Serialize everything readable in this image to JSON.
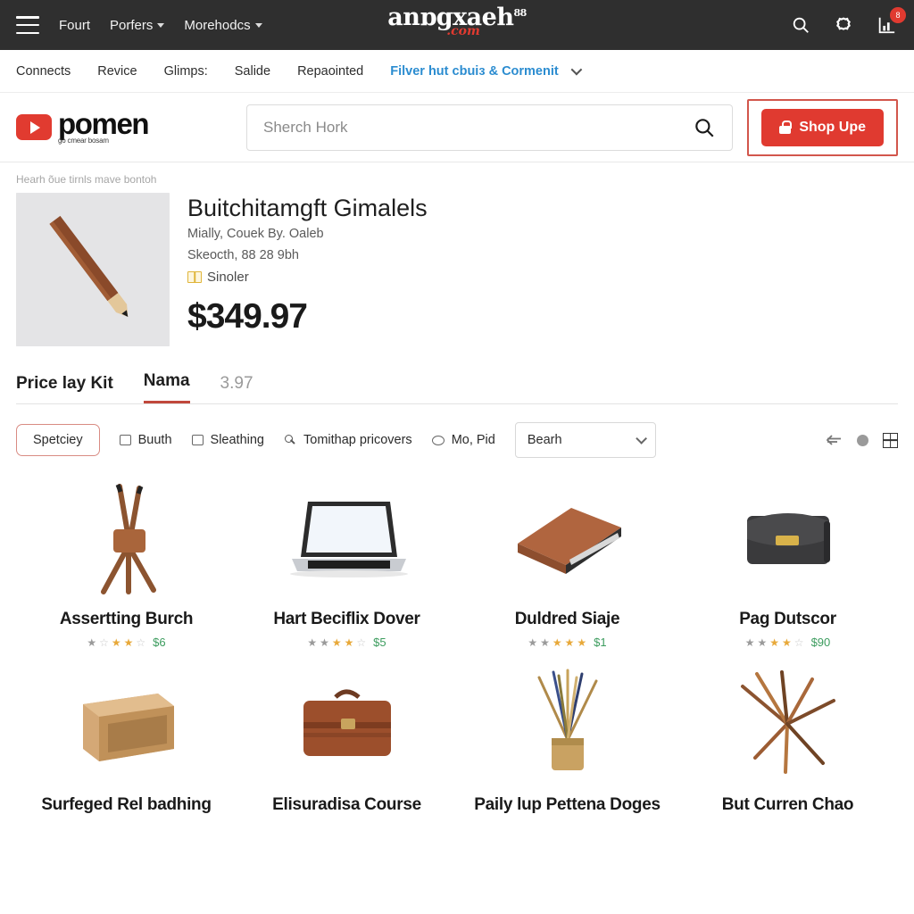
{
  "topbar": {
    "menu_icon": "hamburger-icon",
    "links": [
      {
        "label": "Fourt",
        "has_caret": false
      },
      {
        "label": "Porfers",
        "has_caret": true
      },
      {
        "label": "Morehodcs",
        "has_caret": true
      }
    ],
    "brand": {
      "word": "anɒgxaeh",
      "sup": "88",
      "dotcom": ".com"
    },
    "icons": [
      {
        "name": "search-icon"
      },
      {
        "name": "gear-icon"
      },
      {
        "name": "cart-icon",
        "badge": "8"
      }
    ]
  },
  "subnav": {
    "items": [
      "Connects",
      "Revice",
      "Glimps:",
      "Salide",
      "Repaointed"
    ],
    "accent": "Filver hut cbuiɜ & Cormenit"
  },
  "header": {
    "logo_text": "pomen",
    "logo_tagline": "go cmear bosam",
    "search": {
      "placeholder": "Sherch Hork",
      "value": ""
    },
    "shop_button": "Shop Upe"
  },
  "product": {
    "breadcrumb": "Hearh õue tirnls mave bontoh",
    "title": "Buitchitamgft Gimalels",
    "meta_line1": "Mially, Couek By. Oaleb",
    "meta_line2": "Skeocth, 88 28 9bh",
    "badge_label": "Sinoler",
    "price": "$349.97"
  },
  "tabs": [
    {
      "label": "Price lay Kit",
      "active": false,
      "muted": false
    },
    {
      "label": "Nama",
      "active": true,
      "muted": false
    },
    {
      "label": "3.97",
      "active": false,
      "muted": true
    }
  ],
  "filters": {
    "primary_chip": "Spetciey",
    "chips": [
      {
        "label": "Buuth",
        "icon": "square-icon"
      },
      {
        "label": "Sleathing",
        "icon": "square-icon"
      },
      {
        "label": "Tomithap pricovers",
        "icon": "key-icon"
      },
      {
        "label": "Mo, Pid",
        "icon": "oval-icon"
      }
    ],
    "select_value": "Bearh",
    "view_icons": [
      "back-arrow-icon",
      "circle-icon",
      "grid-view-icon"
    ]
  },
  "grid": {
    "items": [
      {
        "name": "Assertting Burch",
        "price": "$6",
        "stars": [
          0,
          0,
          1,
          1,
          0
        ],
        "image": "pencil-tripod"
      },
      {
        "name": "Hart Beciflix Dover",
        "price": "$5",
        "stars": [
          0,
          0,
          1,
          1,
          0
        ],
        "image": "silver-laptop"
      },
      {
        "name": "Duldred Siaje",
        "price": "$1",
        "stars": [
          0,
          0,
          1,
          1,
          1
        ],
        "image": "brown-laptop-case"
      },
      {
        "name": "Pag Dutscor",
        "price": "$90",
        "stars": [
          0,
          0,
          1,
          1,
          0
        ],
        "image": "black-handbag"
      },
      {
        "name": "Surfeged Rel badhing",
        "price": "",
        "stars": [],
        "image": "cardboard-shelf"
      },
      {
        "name": "Elisuradisa Course",
        "price": "",
        "stars": [],
        "image": "brown-suitcase"
      },
      {
        "name": "Paily lup Pettena Doges",
        "price": "",
        "stars": [],
        "image": "reed-diffuser"
      },
      {
        "name": "But Curren Chao",
        "price": "",
        "stars": [],
        "image": "colored-pencils"
      }
    ]
  },
  "colors": {
    "topbar_bg": "#2f2f2f",
    "accent_red": "#e03a30",
    "link_blue": "#2b8cd0",
    "price_green": "#3c9c5e",
    "star_gold": "#e8a93a"
  }
}
